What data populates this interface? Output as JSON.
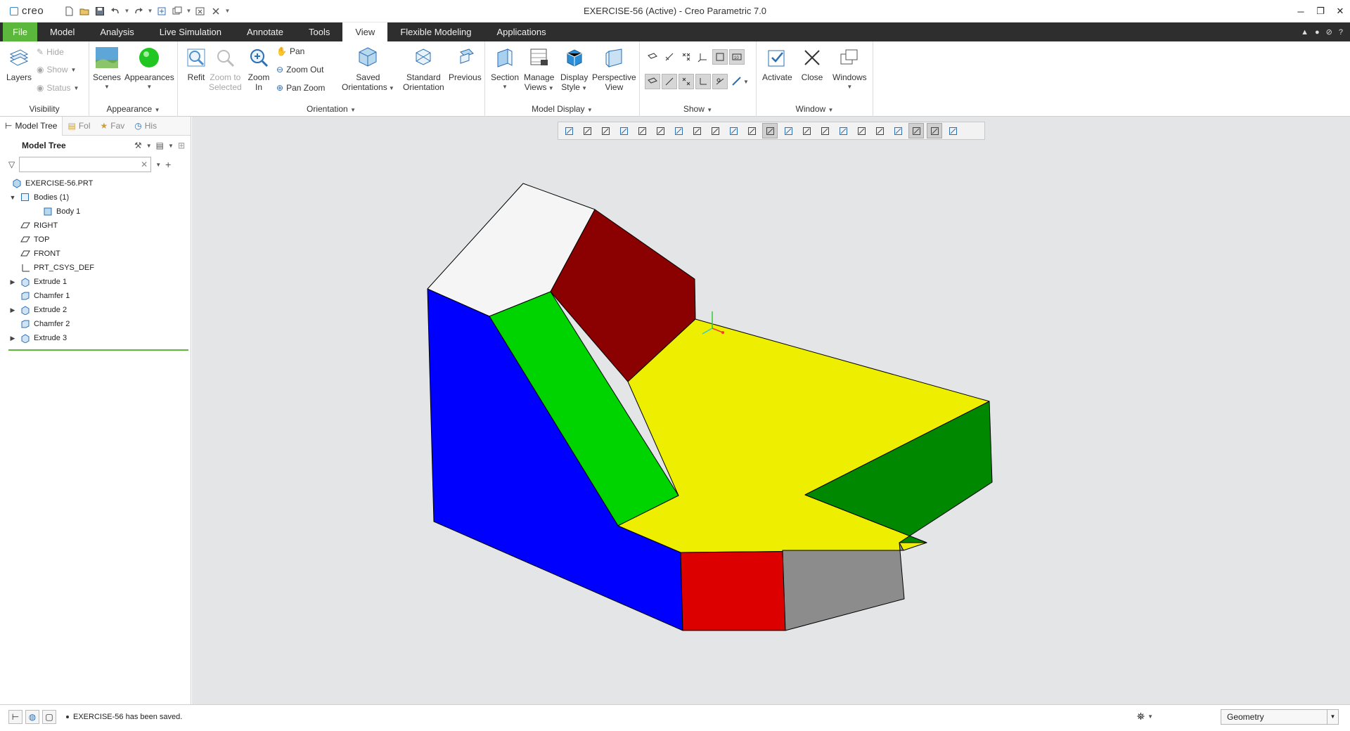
{
  "titlebar": {
    "logo": "creo",
    "title": "EXERCISE-56 (Active) - Creo Parametric 7.0"
  },
  "tabs": [
    {
      "label": "File"
    },
    {
      "label": "Model"
    },
    {
      "label": "Analysis"
    },
    {
      "label": "Live Simulation"
    },
    {
      "label": "Annotate"
    },
    {
      "label": "Tools"
    },
    {
      "label": "View"
    },
    {
      "label": "Flexible Modeling"
    },
    {
      "label": "Applications"
    }
  ],
  "ribbon": {
    "visibility": {
      "label": "Visibility",
      "layers": "Layers",
      "hide": "Hide",
      "show": "Show",
      "status": "Status"
    },
    "appearance": {
      "label": "Appearance",
      "scenes": "Scenes",
      "appearances": "Appearances"
    },
    "orientation": {
      "label": "Orientation",
      "refit": "Refit",
      "zoom_to_selected_1": "Zoom to",
      "zoom_to_selected_2": "Selected",
      "zoom_in_1": "Zoom",
      "zoom_in_2": "In",
      "pan": "Pan",
      "zoom_out": "Zoom Out",
      "pan_zoom": "Pan Zoom",
      "saved_1": "Saved",
      "saved_2": "Orientations",
      "standard_1": "Standard",
      "standard_2": "Orientation",
      "previous": "Previous"
    },
    "model_display": {
      "label": "Model Display",
      "section": "Section",
      "manage_1": "Manage",
      "manage_2": "Views",
      "display_1": "Display",
      "display_2": "Style",
      "perspective_1": "Perspective",
      "perspective_2": "View"
    },
    "show": {
      "label": "Show"
    },
    "window": {
      "label": "Window",
      "activate": "Activate",
      "close": "Close",
      "windows": "Windows"
    }
  },
  "panel": {
    "tabs": [
      "Model Tree",
      "Fol",
      "Fav",
      "His"
    ],
    "tree_title": "Model Tree",
    "filter_placeholder": "",
    "items": [
      {
        "label": "EXERCISE-56.PRT",
        "icon": "part-icon",
        "indent": 0,
        "expand": ""
      },
      {
        "label": "Bodies (1)",
        "icon": "bodies-icon",
        "indent": 1,
        "expand": "▼"
      },
      {
        "label": "Body 1",
        "icon": "body-icon",
        "indent": 2,
        "expand": ""
      },
      {
        "label": "RIGHT",
        "icon": "datum-plane-icon",
        "indent": 1,
        "expand": ""
      },
      {
        "label": "TOP",
        "icon": "datum-plane-icon",
        "indent": 1,
        "expand": ""
      },
      {
        "label": "FRONT",
        "icon": "datum-plane-icon",
        "indent": 1,
        "expand": ""
      },
      {
        "label": "PRT_CSYS_DEF",
        "icon": "csys-icon",
        "indent": 1,
        "expand": ""
      },
      {
        "label": "Extrude 1",
        "icon": "extrude-icon",
        "indent": 1,
        "expand": "▶"
      },
      {
        "label": "Chamfer 1",
        "icon": "chamfer-icon",
        "indent": 1,
        "expand": ""
      },
      {
        "label": "Extrude 2",
        "icon": "extrude-icon",
        "indent": 1,
        "expand": "▶"
      },
      {
        "label": "Chamfer 2",
        "icon": "chamfer-icon",
        "indent": 1,
        "expand": ""
      },
      {
        "label": "Extrude 3",
        "icon": "extrude-icon",
        "indent": 1,
        "expand": "▶"
      }
    ]
  },
  "model": {
    "face_colors": {
      "top_white": "#f5f5f5",
      "chamfer_green": "#00d400",
      "back_maroon": "#8b0000",
      "left_blue": "#0000ff",
      "top_yellow": "#eeee00",
      "right_green": "#008800",
      "front_red": "#dd0000",
      "side_gray": "#8c8c8c"
    }
  },
  "status": {
    "message": "EXERCISE-56 has been saved.",
    "filter": "Geometry"
  },
  "colors": {
    "accent_green": "#5cb83c",
    "tabbar": "#2e2e2e",
    "graphics_bg": "#e3e5e7"
  }
}
